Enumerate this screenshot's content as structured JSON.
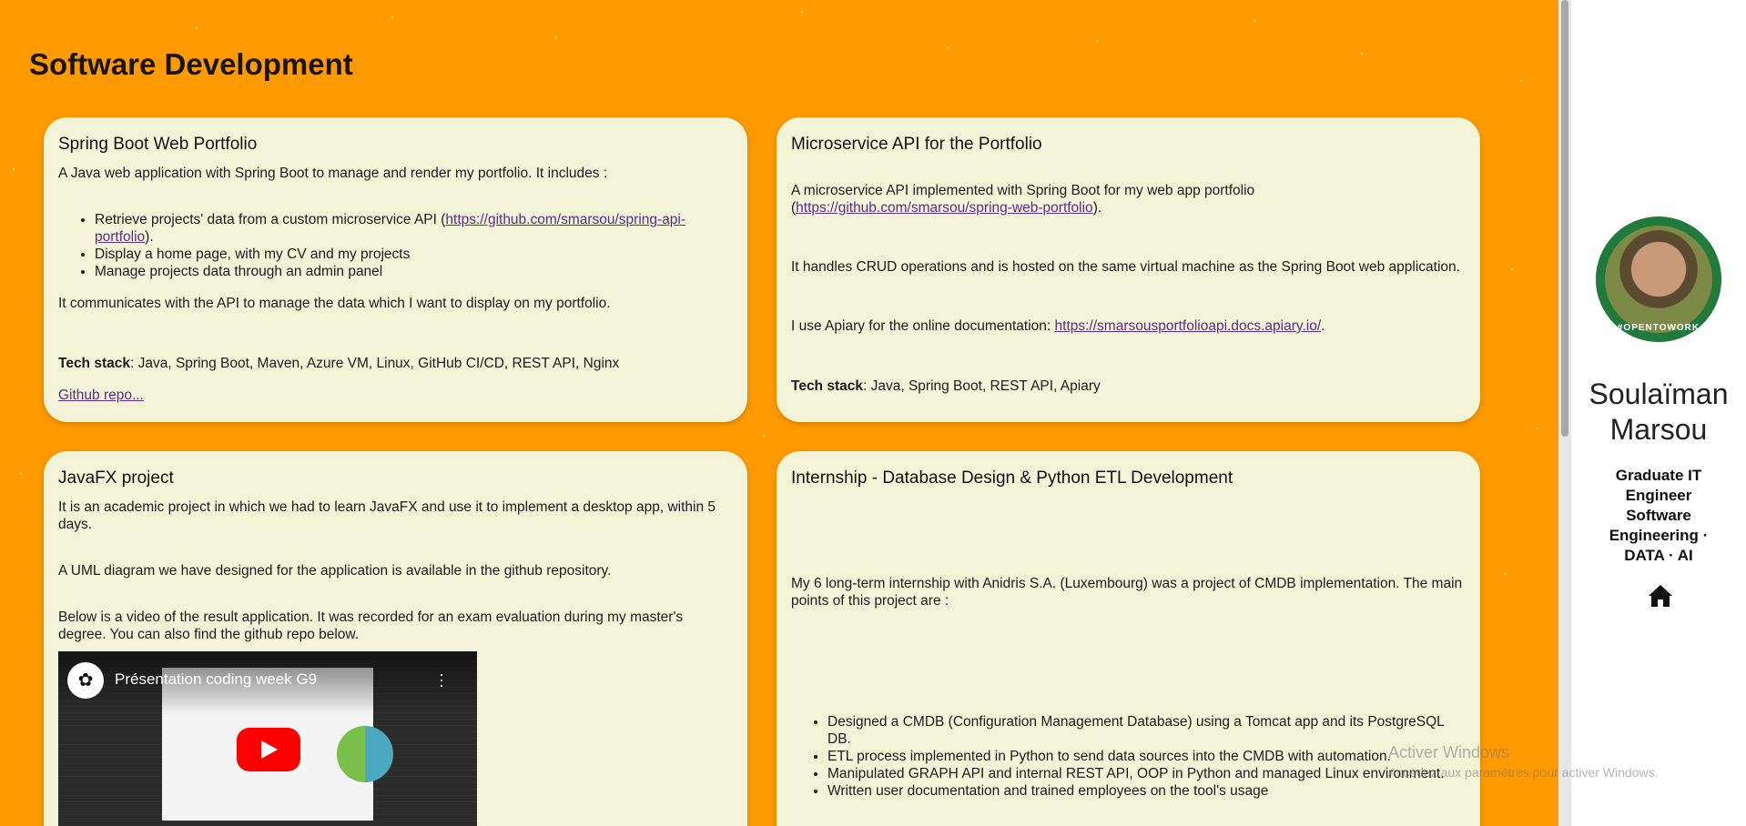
{
  "section": {
    "title": "Software Development"
  },
  "cards": [
    {
      "title": "Spring Boot Web Portfolio",
      "intro": "A Java web application with Spring Boot to manage and render my portfolio. It includes :",
      "bullets": [
        {
          "text": "Retrieve projects' data from a custom microservice API (",
          "link": "https://github.com/smarsou/spring-api-portfolio",
          "after": ")."
        },
        {
          "text": "Display a home page, with my CV and my projects"
        },
        {
          "text": "Manage projects data through an admin panel"
        }
      ],
      "para": "It communicates with the API to manage the data which I want to display on my portfolio.",
      "tech_label": "Tech stack",
      "tech_value": ": Java, Spring Boot, Maven, Azure VM, Linux, GitHub CI/CD, REST API, Nginx",
      "repo_link": "Github repo..."
    },
    {
      "title": "Microservice API for the Portfolio",
      "p1": "A microservice API implemented with Spring Boot for my web app portfolio (",
      "p1_link": "https://github.com/smarsou/spring-web-portfolio",
      "p1_after": ").",
      "p2": "It handles CRUD operations and is hosted on the same virtual machine as the Spring Boot web application.",
      "p3": "I use Apiary for the online documentation: ",
      "p3_link": "https://smarsousportfolioapi.docs.apiary.io/",
      "p3_after": ".",
      "tech_label": "Tech stack",
      "tech_value": ": Java, Spring Boot, REST API, Apiary"
    },
    {
      "title": "JavaFX project",
      "p1": "It is an academic project in which we had to learn JavaFX and use it to implement a desktop app, within 5 days.",
      "p2": "A UML diagram we have designed for the application is available in the github repository.",
      "p3": "Below is a video of the result application. It was recorded for an exam evaluation during my master's degree. You can also find the github repo below.",
      "video_title": "Présentation coding week G9"
    },
    {
      "title": "Internship - Database Design & Python ETL Development",
      "intro": "My 6 long-term internship with Anidris S.A. (Luxembourg) was a project of CMDB implementation. The main points of this project are :",
      "bullets": [
        "Designed a CMDB (Configuration Management Database) using a Tomcat app and its PostgreSQL DB.",
        "ETL process implemented in Python to send data sources into the CMDB with automation.",
        "Manipulated GRAPH API and internal REST API, OOP in Python and managed Linux environment.",
        "Written user documentation and trained employees on the tool's usage"
      ]
    }
  ],
  "profile": {
    "name_first": "Soulaïman",
    "name_last": "Marsou",
    "role": "Graduate IT Engineer Software Engineering · DATA · AI",
    "avatar_badge": "#OPENTOWORK",
    "home_icon": "home-icon"
  },
  "watermark": {
    "title": "Activer Windows",
    "subtitle": "Accédez aux paramètres pour activer Windows."
  }
}
